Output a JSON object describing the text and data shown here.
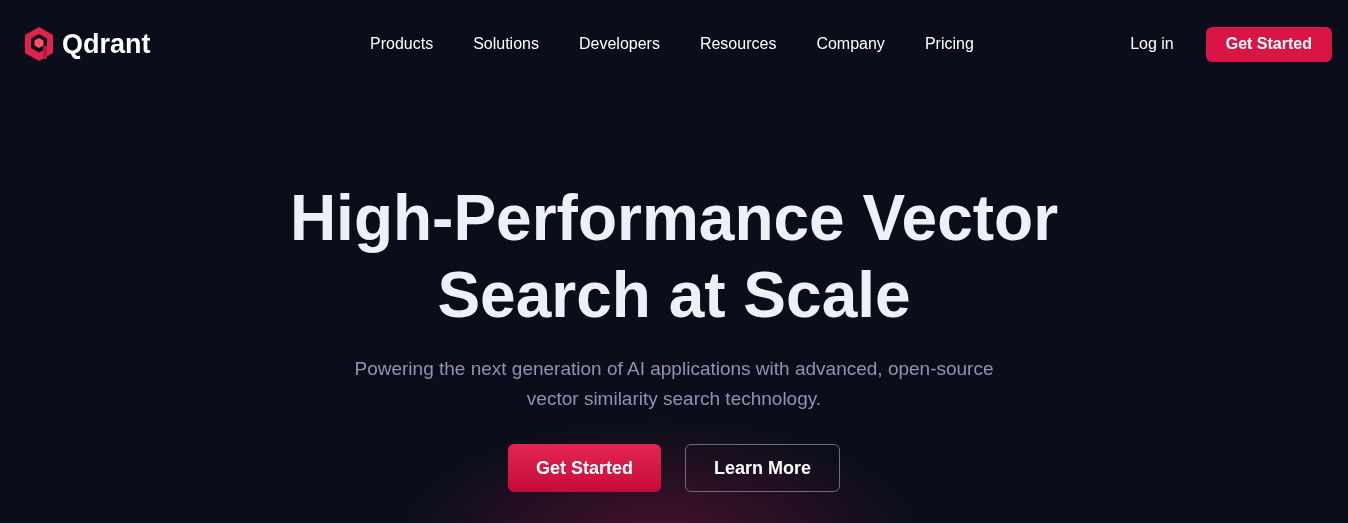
{
  "brand": {
    "name": "Qdrant"
  },
  "nav": {
    "items": [
      "Products",
      "Solutions",
      "Developers",
      "Resources",
      "Company",
      "Pricing"
    ],
    "login": "Log in",
    "cta": "Get Started"
  },
  "hero": {
    "title_lines": [
      "High-Performance Vector",
      "Search at Scale"
    ],
    "subtitle": "Powering the next generation of AI applications with advanced, open-source vector similarity search technology.",
    "buttons": [
      {
        "label": "Get Started",
        "kind": "primary"
      },
      {
        "label": "Learn More",
        "kind": "outline"
      }
    ]
  }
}
